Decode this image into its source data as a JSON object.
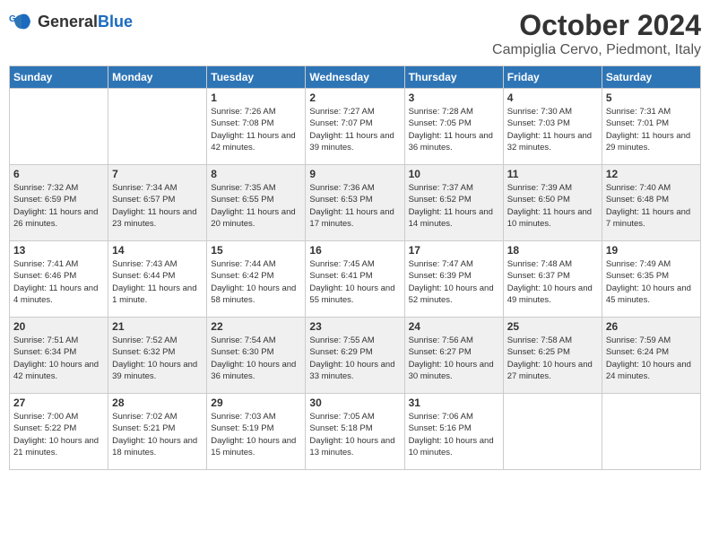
{
  "header": {
    "logo_general": "General",
    "logo_blue": "Blue",
    "month_year": "October 2024",
    "location": "Campiglia Cervo, Piedmont, Italy"
  },
  "weekdays": [
    "Sunday",
    "Monday",
    "Tuesday",
    "Wednesday",
    "Thursday",
    "Friday",
    "Saturday"
  ],
  "weeks": [
    [
      {
        "day": "",
        "info": ""
      },
      {
        "day": "",
        "info": ""
      },
      {
        "day": "1",
        "info": "Sunrise: 7:26 AM\nSunset: 7:08 PM\nDaylight: 11 hours and 42 minutes."
      },
      {
        "day": "2",
        "info": "Sunrise: 7:27 AM\nSunset: 7:07 PM\nDaylight: 11 hours and 39 minutes."
      },
      {
        "day": "3",
        "info": "Sunrise: 7:28 AM\nSunset: 7:05 PM\nDaylight: 11 hours and 36 minutes."
      },
      {
        "day": "4",
        "info": "Sunrise: 7:30 AM\nSunset: 7:03 PM\nDaylight: 11 hours and 32 minutes."
      },
      {
        "day": "5",
        "info": "Sunrise: 7:31 AM\nSunset: 7:01 PM\nDaylight: 11 hours and 29 minutes."
      }
    ],
    [
      {
        "day": "6",
        "info": "Sunrise: 7:32 AM\nSunset: 6:59 PM\nDaylight: 11 hours and 26 minutes."
      },
      {
        "day": "7",
        "info": "Sunrise: 7:34 AM\nSunset: 6:57 PM\nDaylight: 11 hours and 23 minutes."
      },
      {
        "day": "8",
        "info": "Sunrise: 7:35 AM\nSunset: 6:55 PM\nDaylight: 11 hours and 20 minutes."
      },
      {
        "day": "9",
        "info": "Sunrise: 7:36 AM\nSunset: 6:53 PM\nDaylight: 11 hours and 17 minutes."
      },
      {
        "day": "10",
        "info": "Sunrise: 7:37 AM\nSunset: 6:52 PM\nDaylight: 11 hours and 14 minutes."
      },
      {
        "day": "11",
        "info": "Sunrise: 7:39 AM\nSunset: 6:50 PM\nDaylight: 11 hours and 10 minutes."
      },
      {
        "day": "12",
        "info": "Sunrise: 7:40 AM\nSunset: 6:48 PM\nDaylight: 11 hours and 7 minutes."
      }
    ],
    [
      {
        "day": "13",
        "info": "Sunrise: 7:41 AM\nSunset: 6:46 PM\nDaylight: 11 hours and 4 minutes."
      },
      {
        "day": "14",
        "info": "Sunrise: 7:43 AM\nSunset: 6:44 PM\nDaylight: 11 hours and 1 minute."
      },
      {
        "day": "15",
        "info": "Sunrise: 7:44 AM\nSunset: 6:42 PM\nDaylight: 10 hours and 58 minutes."
      },
      {
        "day": "16",
        "info": "Sunrise: 7:45 AM\nSunset: 6:41 PM\nDaylight: 10 hours and 55 minutes."
      },
      {
        "day": "17",
        "info": "Sunrise: 7:47 AM\nSunset: 6:39 PM\nDaylight: 10 hours and 52 minutes."
      },
      {
        "day": "18",
        "info": "Sunrise: 7:48 AM\nSunset: 6:37 PM\nDaylight: 10 hours and 49 minutes."
      },
      {
        "day": "19",
        "info": "Sunrise: 7:49 AM\nSunset: 6:35 PM\nDaylight: 10 hours and 45 minutes."
      }
    ],
    [
      {
        "day": "20",
        "info": "Sunrise: 7:51 AM\nSunset: 6:34 PM\nDaylight: 10 hours and 42 minutes."
      },
      {
        "day": "21",
        "info": "Sunrise: 7:52 AM\nSunset: 6:32 PM\nDaylight: 10 hours and 39 minutes."
      },
      {
        "day": "22",
        "info": "Sunrise: 7:54 AM\nSunset: 6:30 PM\nDaylight: 10 hours and 36 minutes."
      },
      {
        "day": "23",
        "info": "Sunrise: 7:55 AM\nSunset: 6:29 PM\nDaylight: 10 hours and 33 minutes."
      },
      {
        "day": "24",
        "info": "Sunrise: 7:56 AM\nSunset: 6:27 PM\nDaylight: 10 hours and 30 minutes."
      },
      {
        "day": "25",
        "info": "Sunrise: 7:58 AM\nSunset: 6:25 PM\nDaylight: 10 hours and 27 minutes."
      },
      {
        "day": "26",
        "info": "Sunrise: 7:59 AM\nSunset: 6:24 PM\nDaylight: 10 hours and 24 minutes."
      }
    ],
    [
      {
        "day": "27",
        "info": "Sunrise: 7:00 AM\nSunset: 5:22 PM\nDaylight: 10 hours and 21 minutes."
      },
      {
        "day": "28",
        "info": "Sunrise: 7:02 AM\nSunset: 5:21 PM\nDaylight: 10 hours and 18 minutes."
      },
      {
        "day": "29",
        "info": "Sunrise: 7:03 AM\nSunset: 5:19 PM\nDaylight: 10 hours and 15 minutes."
      },
      {
        "day": "30",
        "info": "Sunrise: 7:05 AM\nSunset: 5:18 PM\nDaylight: 10 hours and 13 minutes."
      },
      {
        "day": "31",
        "info": "Sunrise: 7:06 AM\nSunset: 5:16 PM\nDaylight: 10 hours and 10 minutes."
      },
      {
        "day": "",
        "info": ""
      },
      {
        "day": "",
        "info": ""
      }
    ]
  ]
}
